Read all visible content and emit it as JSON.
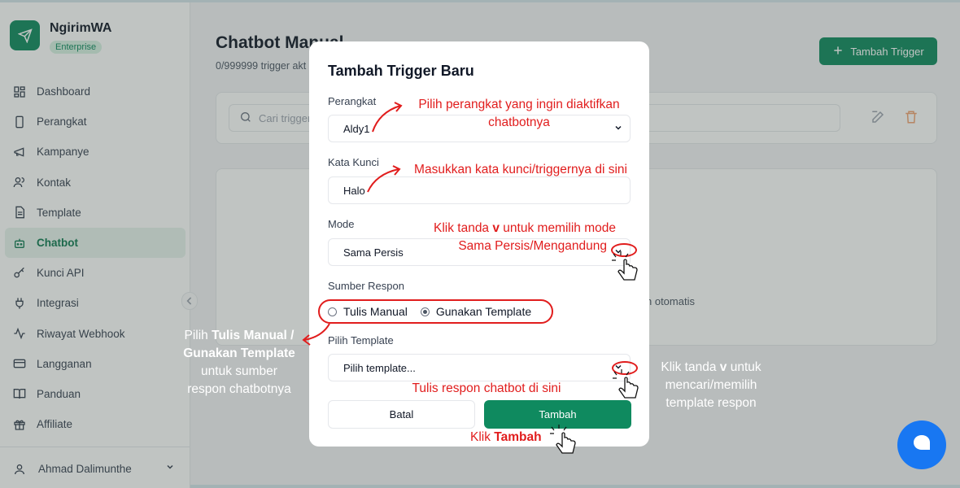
{
  "brand": {
    "name": "NgirimWA",
    "badge": "Enterprise"
  },
  "nav": [
    {
      "label": "Dashboard",
      "icon": "dashboard-icon"
    },
    {
      "label": "Perangkat",
      "icon": "device-icon"
    },
    {
      "label": "Kampanye",
      "icon": "megaphone-icon"
    },
    {
      "label": "Kontak",
      "icon": "contacts-icon"
    },
    {
      "label": "Template",
      "icon": "document-icon"
    },
    {
      "label": "Chatbot",
      "icon": "bot-icon"
    },
    {
      "label": "Kunci API",
      "icon": "key-icon"
    },
    {
      "label": "Integrasi",
      "icon": "plug-icon"
    },
    {
      "label": "Riwayat Webhook",
      "icon": "activity-icon"
    },
    {
      "label": "Langganan",
      "icon": "credit-card-icon"
    },
    {
      "label": "Panduan",
      "icon": "book-icon"
    },
    {
      "label": "Affiliate",
      "icon": "gift-icon"
    }
  ],
  "user": {
    "name": "Ahmad Dalimunthe"
  },
  "page": {
    "title": "Chatbot Manual",
    "subtitle": "0/999999 trigger akt",
    "add_button": "Tambah Trigger",
    "search_placeholder": "Cari trigger",
    "empty_text": "n otomatis"
  },
  "modal": {
    "title": "Tambah Trigger Baru",
    "device_label": "Perangkat",
    "device_value": "Aldy1",
    "keyword_label": "Kata Kunci",
    "keyword_value": "Halo",
    "mode_label": "Mode",
    "mode_value": "Sama Persis",
    "source_label": "Sumber Respon",
    "source_options": [
      "Tulis Manual",
      "Gunakan Template"
    ],
    "source_selected": "Gunakan Template",
    "template_label": "Pilih Template",
    "template_placeholder": "Pilih template...",
    "cancel": "Batal",
    "submit": "Tambah"
  },
  "annotations": {
    "device_1": "Pilih perangkat yang ingin diaktifkan",
    "device_2": "chatbotnya",
    "keyword": "Masukkan kata kunci/triggernya di sini",
    "mode_1a": "Klik tanda ",
    "mode_1b": "v",
    "mode_1c": " untuk memilih mode",
    "mode_2": "Sama Persis/Mengandung",
    "source_a": "Pilih ",
    "source_b": "Tulis Manual /",
    "source_c": "Gunakan Template",
    "source_d": "untuk sumber",
    "source_e": "respon chatbotnya",
    "template_a": "Klik tanda ",
    "template_b": "v",
    "template_c": " untuk",
    "template_d": "mencari/memilih",
    "template_e": "template respon",
    "response": "Tulis respon chatbot di sini",
    "submit_a": "Klik ",
    "submit_b": "Tambah"
  },
  "colors": {
    "primary": "#0f8a5f",
    "annotation": "#e11d1d",
    "chat": "#1877f2"
  }
}
